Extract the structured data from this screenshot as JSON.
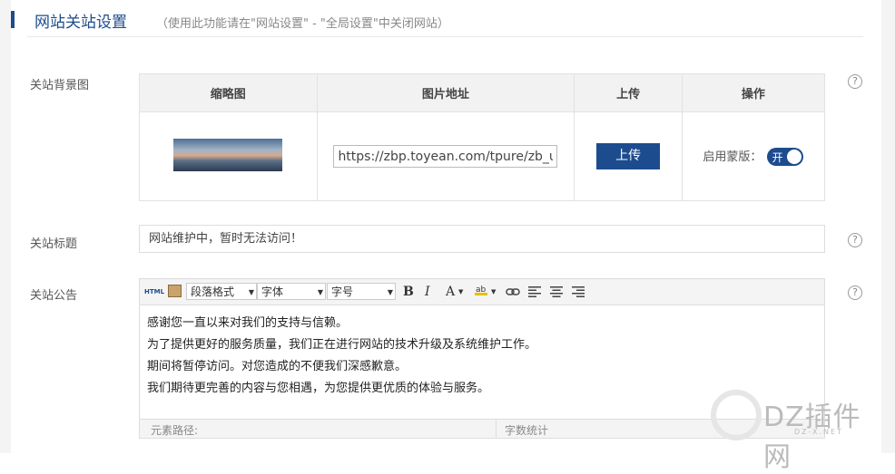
{
  "header": {
    "title": "网站关站设置",
    "subtitle": "（使用此功能请在\"网站设置\" - \"全局设置\"中关闭网站）"
  },
  "bg_section": {
    "label": "关站背景图",
    "columns": [
      "缩略图",
      "图片地址",
      "上传",
      "操作"
    ],
    "url_value": "https://zbp.toyean.com/tpure/zb_us",
    "upload_label": "上传",
    "overlay_label": "启用蒙版：",
    "toggle_text": "开",
    "toggle_on": true
  },
  "title_section": {
    "label": "关站标题",
    "value": "网站维护中，暂时无法访问！"
  },
  "notice_section": {
    "label": "关站公告",
    "toolbar": {
      "html": "HTML",
      "paragraph": "段落格式",
      "font": "字体",
      "size": "字号",
      "bold": "B",
      "italic": "I",
      "fontcolor": "A"
    },
    "lines": [
      "感谢您一直以来对我们的支持与信赖。",
      "为了提供更好的服务质量，我们正在进行网站的技术升级及系统维护工作。",
      "期间将暂停访问。对您造成的不便我们深感歉意。",
      "我们期待更完善的内容与您相遇，为您提供更优质的体验与服务。"
    ],
    "footer_path": "元素路径:",
    "footer_count": "字数统计"
  },
  "help_icon": "?",
  "watermark": {
    "text": "DZ插件网",
    "sub": "DZ-X.NET"
  },
  "colors": {
    "accent": "#1d4c8e"
  }
}
